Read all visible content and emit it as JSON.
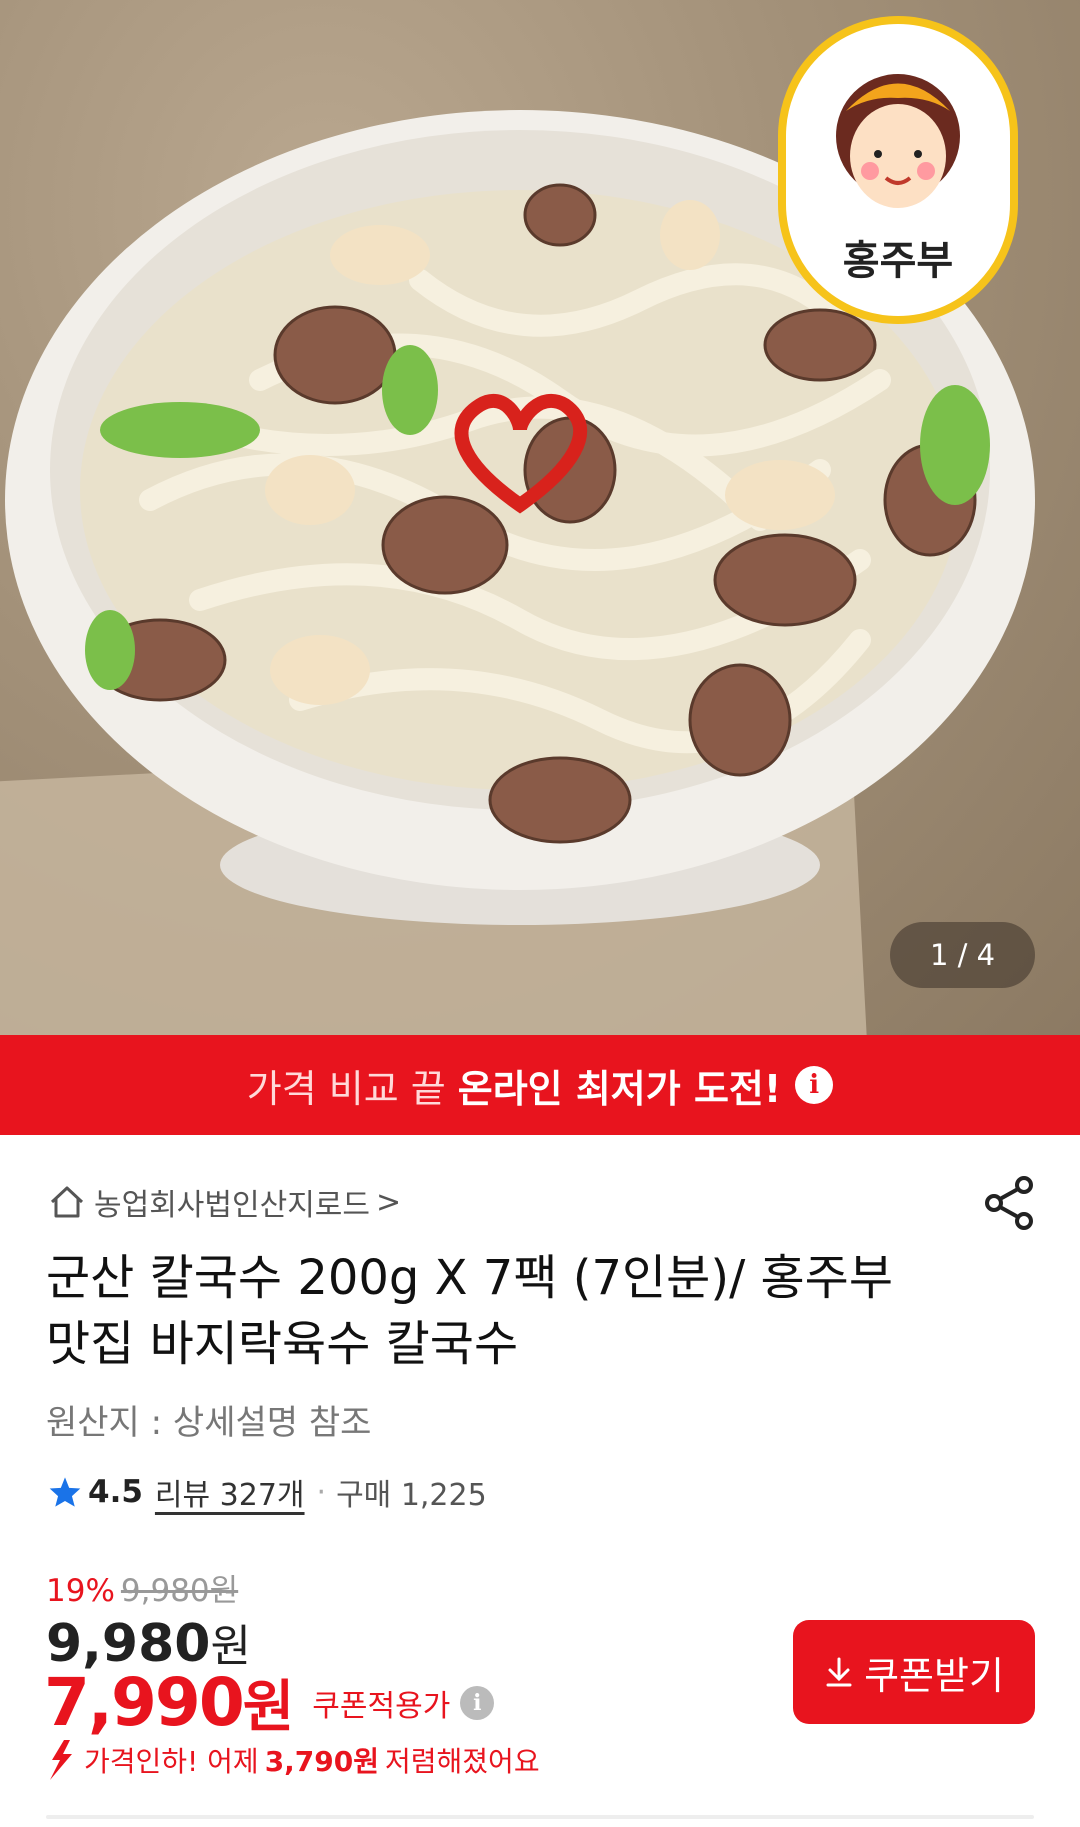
{
  "gallery": {
    "counter": "1 / 4",
    "brand_logo_text": "홍주부"
  },
  "promo_banner": {
    "prefix": "가격 비교 끝",
    "highlight": "온라인 최저가 도전!",
    "info_icon": "info-icon"
  },
  "store": {
    "name": "농업회사법인산지로드",
    "chevron": ">"
  },
  "product": {
    "title": "군산 칼국수 200g X 7팩 (7인분)/ 홍주부 맛집 바지락육수 칼국수",
    "origin": "원산지 : 상세설명 참조"
  },
  "rating": {
    "score": "4.5",
    "reviews": "리뷰 327개",
    "separator": "·",
    "purchases": "구매 1,225"
  },
  "pricing": {
    "discount_pct": "19%",
    "original": "9,980원",
    "price": "9,980",
    "price_unit": "원",
    "sale_price": "7,990",
    "sale_unit": "원",
    "sale_label": "쿠폰적용가",
    "drop_prefix": "가격인하! 어제",
    "drop_amount": "3,790원",
    "drop_suffix": "저렴해졌어요"
  },
  "coupon_button": {
    "label": "쿠폰받기"
  },
  "colors": {
    "accent": "#e8141e",
    "text": "#111111",
    "muted": "#777777",
    "star": "#1a73e8"
  }
}
